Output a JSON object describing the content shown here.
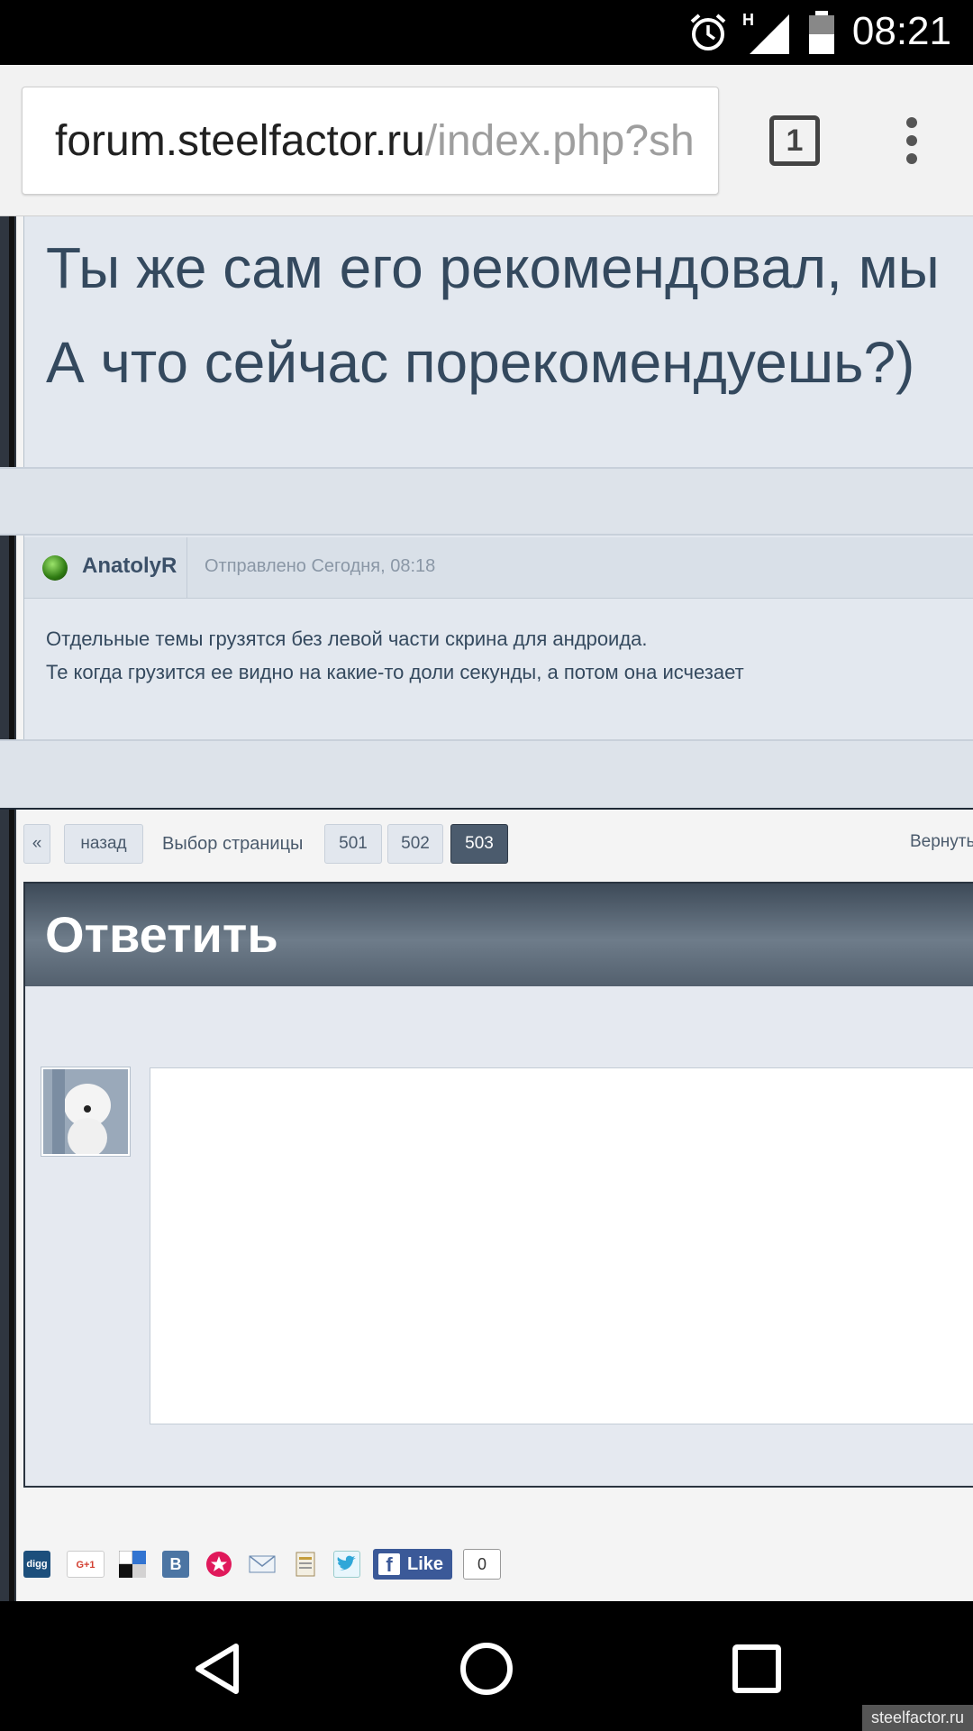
{
  "status_bar": {
    "time": "08:21",
    "network_type": "H"
  },
  "browser": {
    "url_host": "forum.steelfactor.ru",
    "url_path": "/index.php?sh",
    "tab_count": "1"
  },
  "post1": {
    "line1": "Ты же сам его рекомендовал, мы",
    "line2": "А что сейчас порекомендуешь?)"
  },
  "post2": {
    "author": "AnatolyR",
    "posted": "Отправлено Сегодня, 08:18",
    "body_line1": "Отдельные темы грузятся без левой части скрина для андроида.",
    "body_line2": "Те когда грузится ее видно на какие-то доли секунды, а потом она исчезает"
  },
  "pager": {
    "first": "«",
    "back": "назад",
    "label": "Выбор страницы",
    "pages": [
      "501",
      "502",
      "503"
    ],
    "current": "503",
    "return": "Вернуть"
  },
  "reply": {
    "title": "Ответить"
  },
  "share": {
    "icons": [
      "digg-icon",
      "google-plus-icon",
      "delicious-icon",
      "vkontakte-icon",
      "favorite-icon",
      "email-icon",
      "print-icon",
      "twitter-icon"
    ],
    "digg_label": "digg",
    "gplus_label": "G+1",
    "vk_label": "B",
    "fb_like": "Like",
    "fb_letter": "f",
    "fb_count": "0"
  },
  "watermark": "steelfactor.ru"
}
